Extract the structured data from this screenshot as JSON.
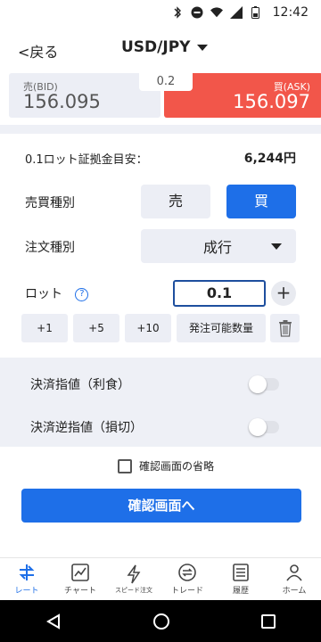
{
  "status_bar": {
    "time": "12:42"
  },
  "header": {
    "back_label": "<戻る",
    "pair": "USD/JPY"
  },
  "quote": {
    "bid_label": "売(BID)",
    "bid_price": "156.095",
    "ask_label": "買(ASK)",
    "ask_price": "156.097",
    "spread": "0.2"
  },
  "margin": {
    "label": "0.1ロット証拠金目安：",
    "value": "6,244円"
  },
  "side": {
    "label": "売買種別",
    "sell": "売",
    "buy": "買",
    "selected": "買"
  },
  "order_type": {
    "label": "注文種別",
    "value": "成行"
  },
  "lot": {
    "label": "ロット",
    "value": "0.1",
    "chips": [
      "+1",
      "+5",
      "+10",
      "発注可能数量"
    ]
  },
  "settlement": {
    "take_profit_label": "決済指値（利食）",
    "stop_loss_label": "決済逆指値（損切）"
  },
  "skip_confirm_label": "確認画面の省略",
  "confirm_button": "確認画面へ",
  "tabs": [
    {
      "label": "レート",
      "icon": "rate-icon",
      "active": true
    },
    {
      "label": "チャート",
      "icon": "chart-icon",
      "active": false
    },
    {
      "label": "スピード注文",
      "icon": "lightning-icon",
      "active": false
    },
    {
      "label": "トレード",
      "icon": "trade-icon",
      "active": false
    },
    {
      "label": "履歴",
      "icon": "history-icon",
      "active": false
    },
    {
      "label": "ホーム",
      "icon": "home-icon",
      "active": false
    }
  ],
  "colors": {
    "accent_blue": "#1e6fe8",
    "ask_red": "#f2564a",
    "panel_gray": "#eceef5"
  }
}
